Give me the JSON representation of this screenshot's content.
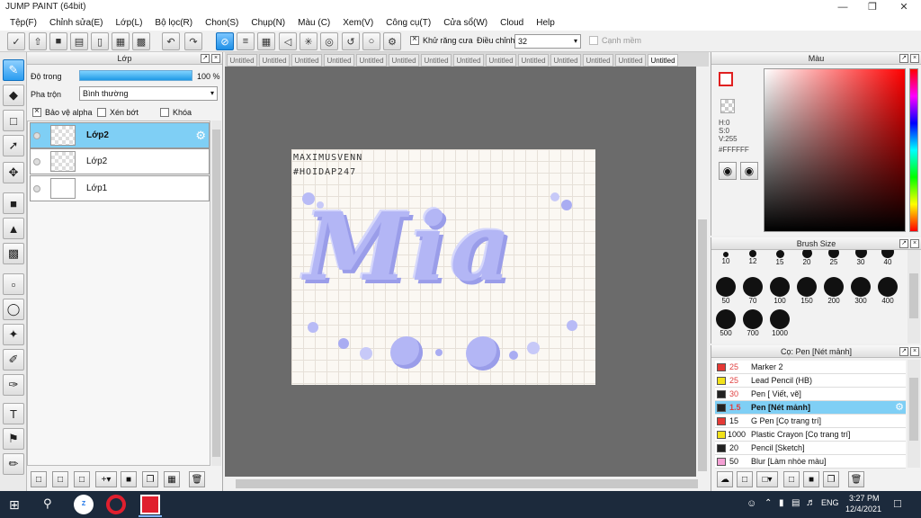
{
  "window": {
    "title": "JUMP PAINT (64bit)"
  },
  "menu": [
    "Tệp(F)",
    "Chỉnh sửa(E)",
    "Lớp(L)",
    "Bộ lọc(R)",
    "Chon(S)",
    "Chụp(N)",
    "Màu (C)",
    "Xem(V)",
    "Công cụ(T)",
    "Cửa sổ(W)",
    "Cloud",
    "Help"
  ],
  "toolbar": {
    "antialias_label": "Khử răng cưa",
    "adjust_label": "Điều chỉnh",
    "adjust_value": "32",
    "smooth_label": "Cạnh mềm"
  },
  "layer_panel": {
    "title": "Lớp",
    "opacity_label": "Độ trong",
    "opacity_value": "100 %",
    "opacity_fraction": 1.0,
    "blend_label": "Pha trộn",
    "blend_value": "Bình thường",
    "protect_alpha": "Bảo vệ alpha",
    "clip": "Xén bớt",
    "lock": "Khóa",
    "layers": [
      {
        "name": "Lớp2",
        "selected": true
      },
      {
        "name": "Lớp2",
        "selected": false
      },
      {
        "name": "Lớp1",
        "selected": false
      }
    ]
  },
  "tabs": [
    "Untitled",
    "Untitled",
    "Untitled",
    "Untitled",
    "Untitled",
    "Untitled",
    "Untitled",
    "Untitled",
    "Untitled",
    "Untitled",
    "Untitled",
    "Untitled",
    "Untitled",
    "Untitled"
  ],
  "artwork": {
    "line1": "MAXIMUSVENN",
    "line2": "#HOIDAP247",
    "word": "Mia"
  },
  "color_panel": {
    "title": "Màu",
    "h": "H:0",
    "s": "S:0",
    "v": "V:255",
    "hex": "#FFFFFF"
  },
  "brush_panel": {
    "title": "Brush Size",
    "sizes": [
      "10",
      "12",
      "15",
      "20",
      "25",
      "30",
      "40",
      "50",
      "70",
      "100",
      "150",
      "200",
      "300",
      "400",
      "500",
      "700",
      "1000"
    ]
  },
  "pen_panel": {
    "title": "Cọ: Pen [Nét mảnh]",
    "items": [
      {
        "size": "25",
        "name": "Marker 2",
        "color": "#e53935"
      },
      {
        "size": "25",
        "name": "Lead Pencil (HB)",
        "color": "#f2e21a"
      },
      {
        "size": "30",
        "name": "Pen [ Viết, vẽ]",
        "color": "#222222"
      },
      {
        "size": "1.5",
        "name": "Pen [Nét mảnh]",
        "color": "#222222",
        "selected": true
      },
      {
        "size": "15",
        "name": "G Pen [Cọ trang trí]",
        "color": "#e53935"
      },
      {
        "size": "1000",
        "name": "Plastic Crayon [Cọ trang trí]",
        "color": "#f2e21a"
      },
      {
        "size": "20",
        "name": "Pencil [Sketch]",
        "color": "#222222"
      },
      {
        "size": "50",
        "name": "Blur [Làm nhòe màu]",
        "color": "#f4a0d4"
      }
    ]
  },
  "taskbar": {
    "lang": "ENG",
    "time": "3:27 PM",
    "date": "12/4/2021"
  }
}
